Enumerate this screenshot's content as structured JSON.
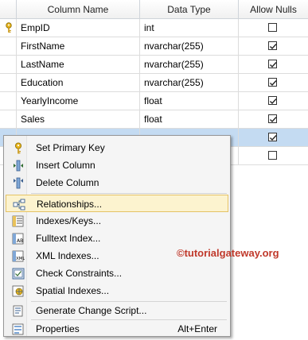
{
  "columns_header": {
    "name": "Column Name",
    "type": "Data Type",
    "nulls": "Allow Nulls"
  },
  "rows": [
    {
      "name": "EmpID",
      "type": "int",
      "allow_nulls": false,
      "primary_key": true
    },
    {
      "name": "FirstName",
      "type": "nvarchar(255)",
      "allow_nulls": true
    },
    {
      "name": "LastName",
      "type": "nvarchar(255)",
      "allow_nulls": true
    },
    {
      "name": "Education",
      "type": "nvarchar(255)",
      "allow_nulls": true
    },
    {
      "name": "YearlyIncome",
      "type": "float",
      "allow_nulls": true
    },
    {
      "name": "Sales",
      "type": "float",
      "allow_nulls": true
    },
    {
      "name": "",
      "type": "",
      "allow_nulls": true,
      "selected": true
    },
    {
      "name": "",
      "type": "",
      "allow_nulls": false
    }
  ],
  "context_menu": {
    "items": [
      {
        "label": "Set Primary Key",
        "icon": "key-icon"
      },
      {
        "label": "Insert Column",
        "icon": "insert-column-icon"
      },
      {
        "label": "Delete Column",
        "icon": "delete-column-icon"
      },
      {
        "label": "Relationships...",
        "icon": "relationships-icon",
        "highlighted": true
      },
      {
        "label": "Indexes/Keys...",
        "icon": "indexes-icon"
      },
      {
        "label": "Fulltext Index...",
        "icon": "fulltext-icon"
      },
      {
        "label": "XML Indexes...",
        "icon": "xml-index-icon"
      },
      {
        "label": "Check Constraints...",
        "icon": "check-constraints-icon"
      },
      {
        "label": "Spatial Indexes...",
        "icon": "spatial-index-icon"
      },
      {
        "label": "Generate Change Script...",
        "icon": "script-icon"
      },
      {
        "label": "Properties",
        "icon": "properties-icon",
        "shortcut": "Alt+Enter"
      }
    ]
  },
  "watermark": "©tutorialgateway.org",
  "colors": {
    "selected_row": "#c4dbf2",
    "menu_highlight": "#fcf3cf",
    "watermark": "#c0392b"
  }
}
